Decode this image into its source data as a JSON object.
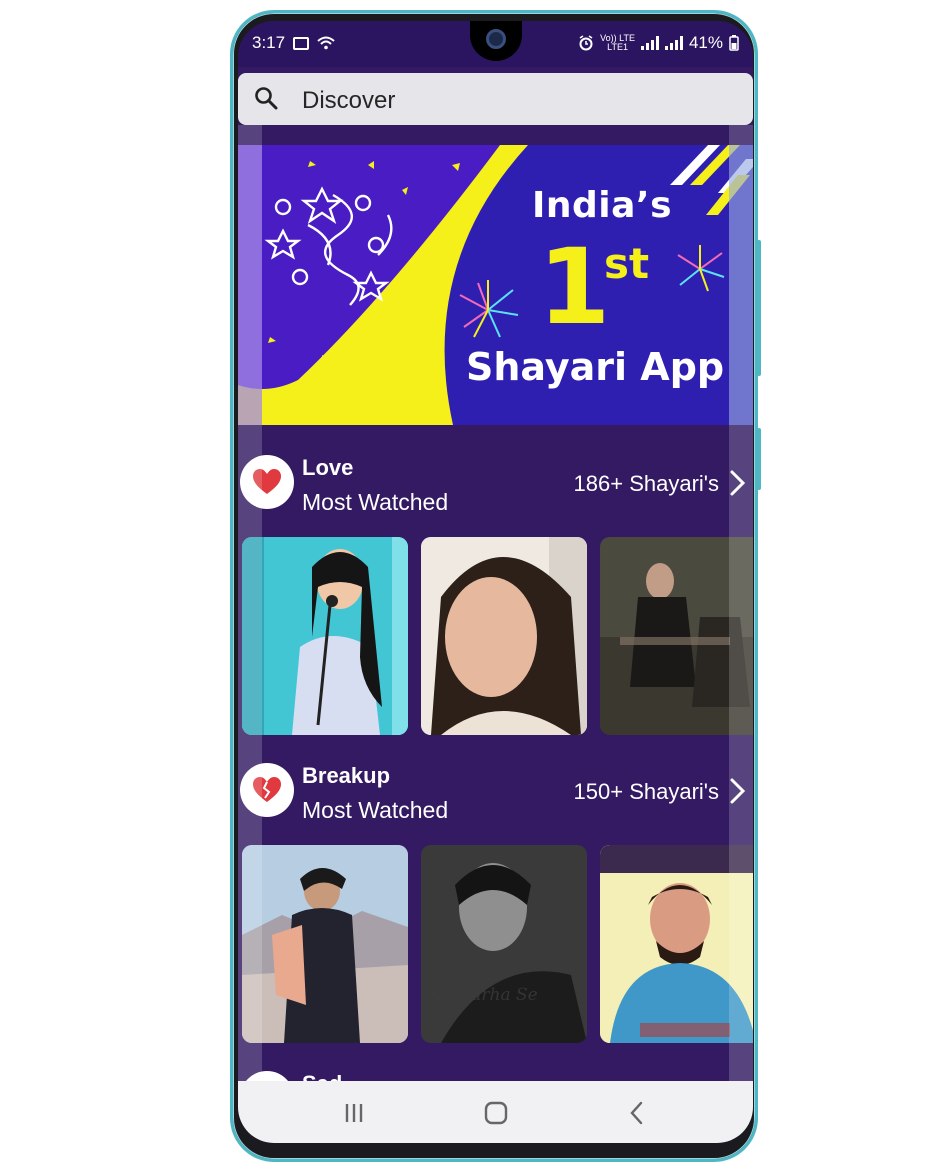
{
  "status_bar": {
    "time": "3:17",
    "volte_label": "Vo)) LTE",
    "lte_label": "LTE1",
    "battery": "41%"
  },
  "search": {
    "label": "Discover"
  },
  "banner": {
    "headline": "India’s",
    "number": "1",
    "ordinal": "st",
    "subline": "Shayari App"
  },
  "categories": [
    {
      "title": "Love",
      "subtitle": "Most Watched",
      "count": "186+ Shayari's",
      "icon": "heart-icon"
    },
    {
      "title": "Breakup",
      "subtitle": "Most Watched",
      "count": "150+ Shayari's",
      "icon": "broken-heart-icon",
      "thumb_caption": "Kis Tarha Se"
    },
    {
      "title": "Sad"
    }
  ],
  "colors": {
    "background": "#331a62",
    "banner": "#2f1fb0",
    "accent_yellow": "#f5f01a",
    "heart_red": "#e0393f",
    "phone_frame": "#4fb7c4"
  }
}
